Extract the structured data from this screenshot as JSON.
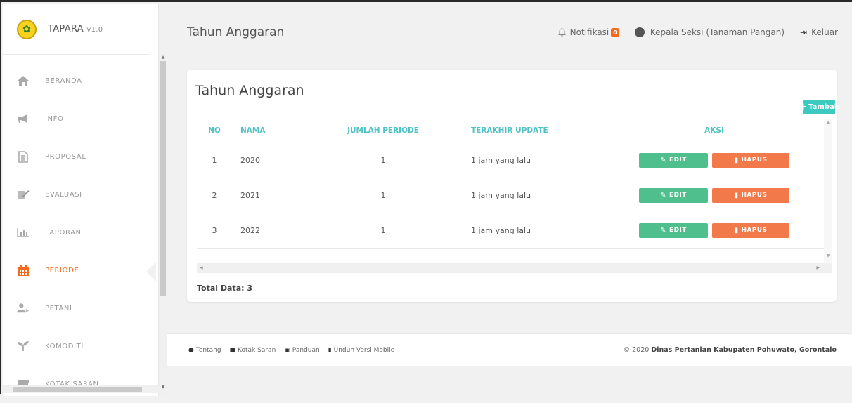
{
  "app": {
    "brand_name": "TAPARA",
    "brand_version": "v1.0"
  },
  "sidebar": {
    "items": [
      {
        "label": "BERANDA",
        "icon": "home-icon"
      },
      {
        "label": "INFO",
        "icon": "megaphone-icon"
      },
      {
        "label": "PROPOSAL",
        "icon": "document-icon"
      },
      {
        "label": "EVALUASI",
        "icon": "edit-icon"
      },
      {
        "label": "LAPORAN",
        "icon": "bar-chart-icon"
      },
      {
        "label": "PERIODE",
        "icon": "calendar-icon",
        "active": true
      },
      {
        "label": "PETANI",
        "icon": "users-icon"
      },
      {
        "label": "KOMODITI",
        "icon": "plant-icon"
      },
      {
        "label": "KOTAK SARAN",
        "icon": "inbox-icon"
      }
    ]
  },
  "header": {
    "title": "Tahun Anggaran",
    "notification_label": "Notifikasi",
    "notification_count": "0",
    "user_label": "Kepala Seksi (Tanaman Pangan)",
    "logout_label": "Keluar"
  },
  "card": {
    "title": "Tahun Anggaran",
    "add_label": "Tambah",
    "columns": [
      "NO",
      "NAMA",
      "JUMLAH PERIODE",
      "TERAKHIR UPDATE",
      "AKSI"
    ],
    "rows": [
      {
        "no": "1",
        "nama": "2020",
        "jumlah": "1",
        "update": "1 jam yang lalu"
      },
      {
        "no": "2",
        "nama": "2021",
        "jumlah": "1",
        "update": "1 jam yang lalu"
      },
      {
        "no": "3",
        "nama": "2022",
        "jumlah": "1",
        "update": "1 jam yang lalu"
      }
    ],
    "edit_label": "EDIT",
    "delete_label": "HAPUS",
    "total_label": "Total Data: 3"
  },
  "footer": {
    "links": [
      "Tentang",
      "Kotak Saran",
      "Panduan",
      "Unduh Versi Mobile"
    ],
    "copyright_prefix": "© 2020",
    "copyright_org": "Dinas Pertanian Kabupaten Pohuwato, Gorontalo"
  },
  "colors": {
    "accent": "#f36a1c",
    "teal": "#3cc9c0",
    "edit_green": "#4fc08d",
    "delete_orange": "#f2794a"
  }
}
